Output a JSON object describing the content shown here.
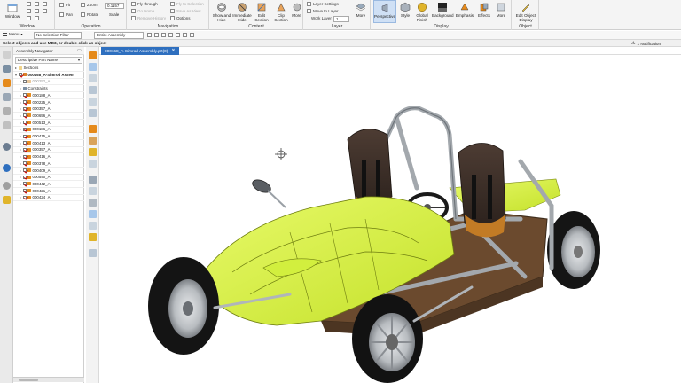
{
  "ribbon": {
    "window": {
      "label": "Window",
      "group": "Window"
    },
    "operation": {
      "fit": "Fit",
      "zoom": "Zoom",
      "zoom_value": "0.1157",
      "pan": "Pan",
      "rotate": "Rotate",
      "scale": "Scale",
      "group": "Operation"
    },
    "navigation": {
      "fly_through": "Fly-through",
      "go_home": "Go Home",
      "remove_history": "Remove History",
      "fly_to_selection": "Fly to Selection",
      "save_as_view": "Save As View",
      "restore_selection": "Recover Selection",
      "options": "Options",
      "group": "Navigation"
    },
    "content": {
      "show_hide": "Show and Hide",
      "immediate_hide": "Immediate Hide",
      "edit_section": "Edit Section",
      "clip_section": "Clip Section",
      "more": "More",
      "group": "Content"
    },
    "layer": {
      "layer_settings": "Layer Settings",
      "move_to_layer": "Move to Layer",
      "work_layer": "Work Layer",
      "work_layer_value": "1",
      "more": "More",
      "group": "Layer"
    },
    "display": {
      "perspective": "Perspective",
      "style": "Style",
      "global_finish": "Global Finish",
      "background": "Background",
      "emphasis": "Emphasis",
      "effects": "Effects",
      "more": "More",
      "group": "Display"
    },
    "object": {
      "edit_object_display": "Edit Object Display",
      "group": "Object"
    }
  },
  "cmdbar": {
    "menu": "Menu",
    "selection_filter": "No Selection Filter",
    "assembly": "Entire Assembly"
  },
  "status": {
    "message": "Select objects and use MB3, or double-click an object",
    "notification": "1 Notification"
  },
  "navigator": {
    "title": "Assembly Navigator",
    "column_header": "Descriptive Part Name",
    "rows": [
      {
        "label": "Sections",
        "level": 0,
        "type": "folder"
      },
      {
        "label": "000168_A-Simrod Assem",
        "level": 0,
        "type": "assembly"
      },
      {
        "label": "000252_A",
        "level": 1,
        "type": "part-dim"
      },
      {
        "label": "Constraints",
        "level": 1,
        "type": "constraint"
      },
      {
        "label": "000188_A",
        "level": 1,
        "type": "part"
      },
      {
        "label": "000225_A",
        "level": 1,
        "type": "part"
      },
      {
        "label": "000357_A",
        "level": 1,
        "type": "part"
      },
      {
        "label": "000656_A",
        "level": 1,
        "type": "part"
      },
      {
        "label": "000513_A",
        "level": 1,
        "type": "part"
      },
      {
        "label": "000186_A",
        "level": 1,
        "type": "part"
      },
      {
        "label": "000415_A",
        "level": 1,
        "type": "part"
      },
      {
        "label": "000413_A",
        "level": 1,
        "type": "part"
      },
      {
        "label": "000357_A",
        "level": 1,
        "type": "part"
      },
      {
        "label": "000416_A",
        "level": 1,
        "type": "part"
      },
      {
        "label": "000378_A",
        "level": 1,
        "type": "part"
      },
      {
        "label": "000409_A",
        "level": 1,
        "type": "part"
      },
      {
        "label": "000540_A",
        "level": 1,
        "type": "part"
      },
      {
        "label": "000442_A",
        "level": 1,
        "type": "part"
      },
      {
        "label": "000421_A",
        "level": 1,
        "type": "part"
      },
      {
        "label": "000424_A",
        "level": 1,
        "type": "part"
      }
    ]
  },
  "tab": {
    "label": "000168_A-Simrod Assembly.prt(0)"
  },
  "colors": {
    "accent": "#2e6fbf",
    "yellow_body": "#d8f23a",
    "brown_panel": "#6b4a2e",
    "frame_grey": "#9aa0a6"
  }
}
